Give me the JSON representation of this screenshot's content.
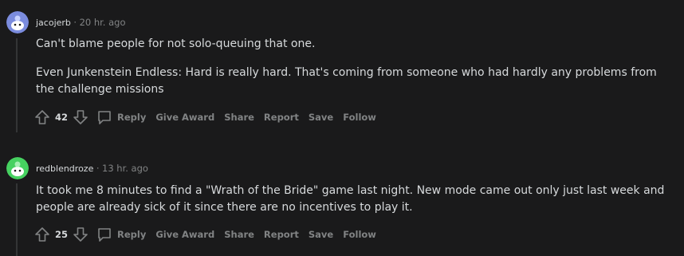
{
  "comments": [
    {
      "username": "jacojerb",
      "separator": "·",
      "timestamp": "20 hr. ago",
      "avatar_color": "#7b8cde",
      "paragraphs": [
        "Can't blame people for not solo-queuing that one.",
        "Even Junkenstein Endless: Hard is really hard. That's coming from someone who had hardly any problems from the challenge missions"
      ],
      "score": "42",
      "actions": {
        "reply": "Reply",
        "give_award": "Give Award",
        "share": "Share",
        "report": "Report",
        "save": "Save",
        "follow": "Follow"
      }
    },
    {
      "username": "redblendroze",
      "separator": "·",
      "timestamp": "13 hr. ago",
      "avatar_color": "#46d160",
      "paragraphs": [
        "It took me 8 minutes to find a \"Wrath of the Bride\" game last night. New mode came out only just last week and people are already sick of it since there are no incentives to play it."
      ],
      "score": "25",
      "actions": {
        "reply": "Reply",
        "give_award": "Give Award",
        "share": "Share",
        "report": "Report",
        "save": "Save",
        "follow": "Follow"
      }
    }
  ],
  "colors": {
    "background": "#1a1a1b",
    "text": "#d7dadc",
    "muted": "#818384",
    "thread_line": "#343536"
  }
}
